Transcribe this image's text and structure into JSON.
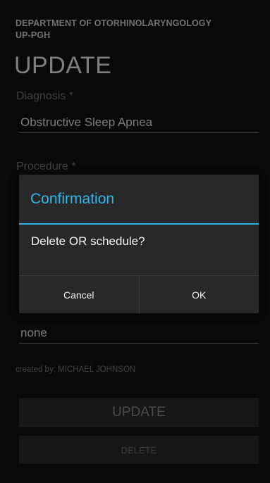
{
  "header": {
    "department_line1": "DEPARTMENT OF OTORHINOLARYNGOLOGY",
    "department_line2": "UP-PGH",
    "title": "UPDATE"
  },
  "form": {
    "diagnosis_label": "Diagnosis *",
    "diagnosis_value": "Obstructive Sleep Apnea",
    "procedure_label": "Procedure *",
    "remarks_value": "none",
    "created_by": "created by: MICHAEL JOHNSON"
  },
  "buttons": {
    "update_label": "UPDATE",
    "delete_label": "DELETE"
  },
  "dialog": {
    "title": "Confirmation",
    "message": "Delete OR schedule?",
    "cancel_label": "Cancel",
    "ok_label": "OK"
  },
  "colors": {
    "accent": "#33b5e5",
    "background": "#111111",
    "dialog_background": "#282828"
  }
}
